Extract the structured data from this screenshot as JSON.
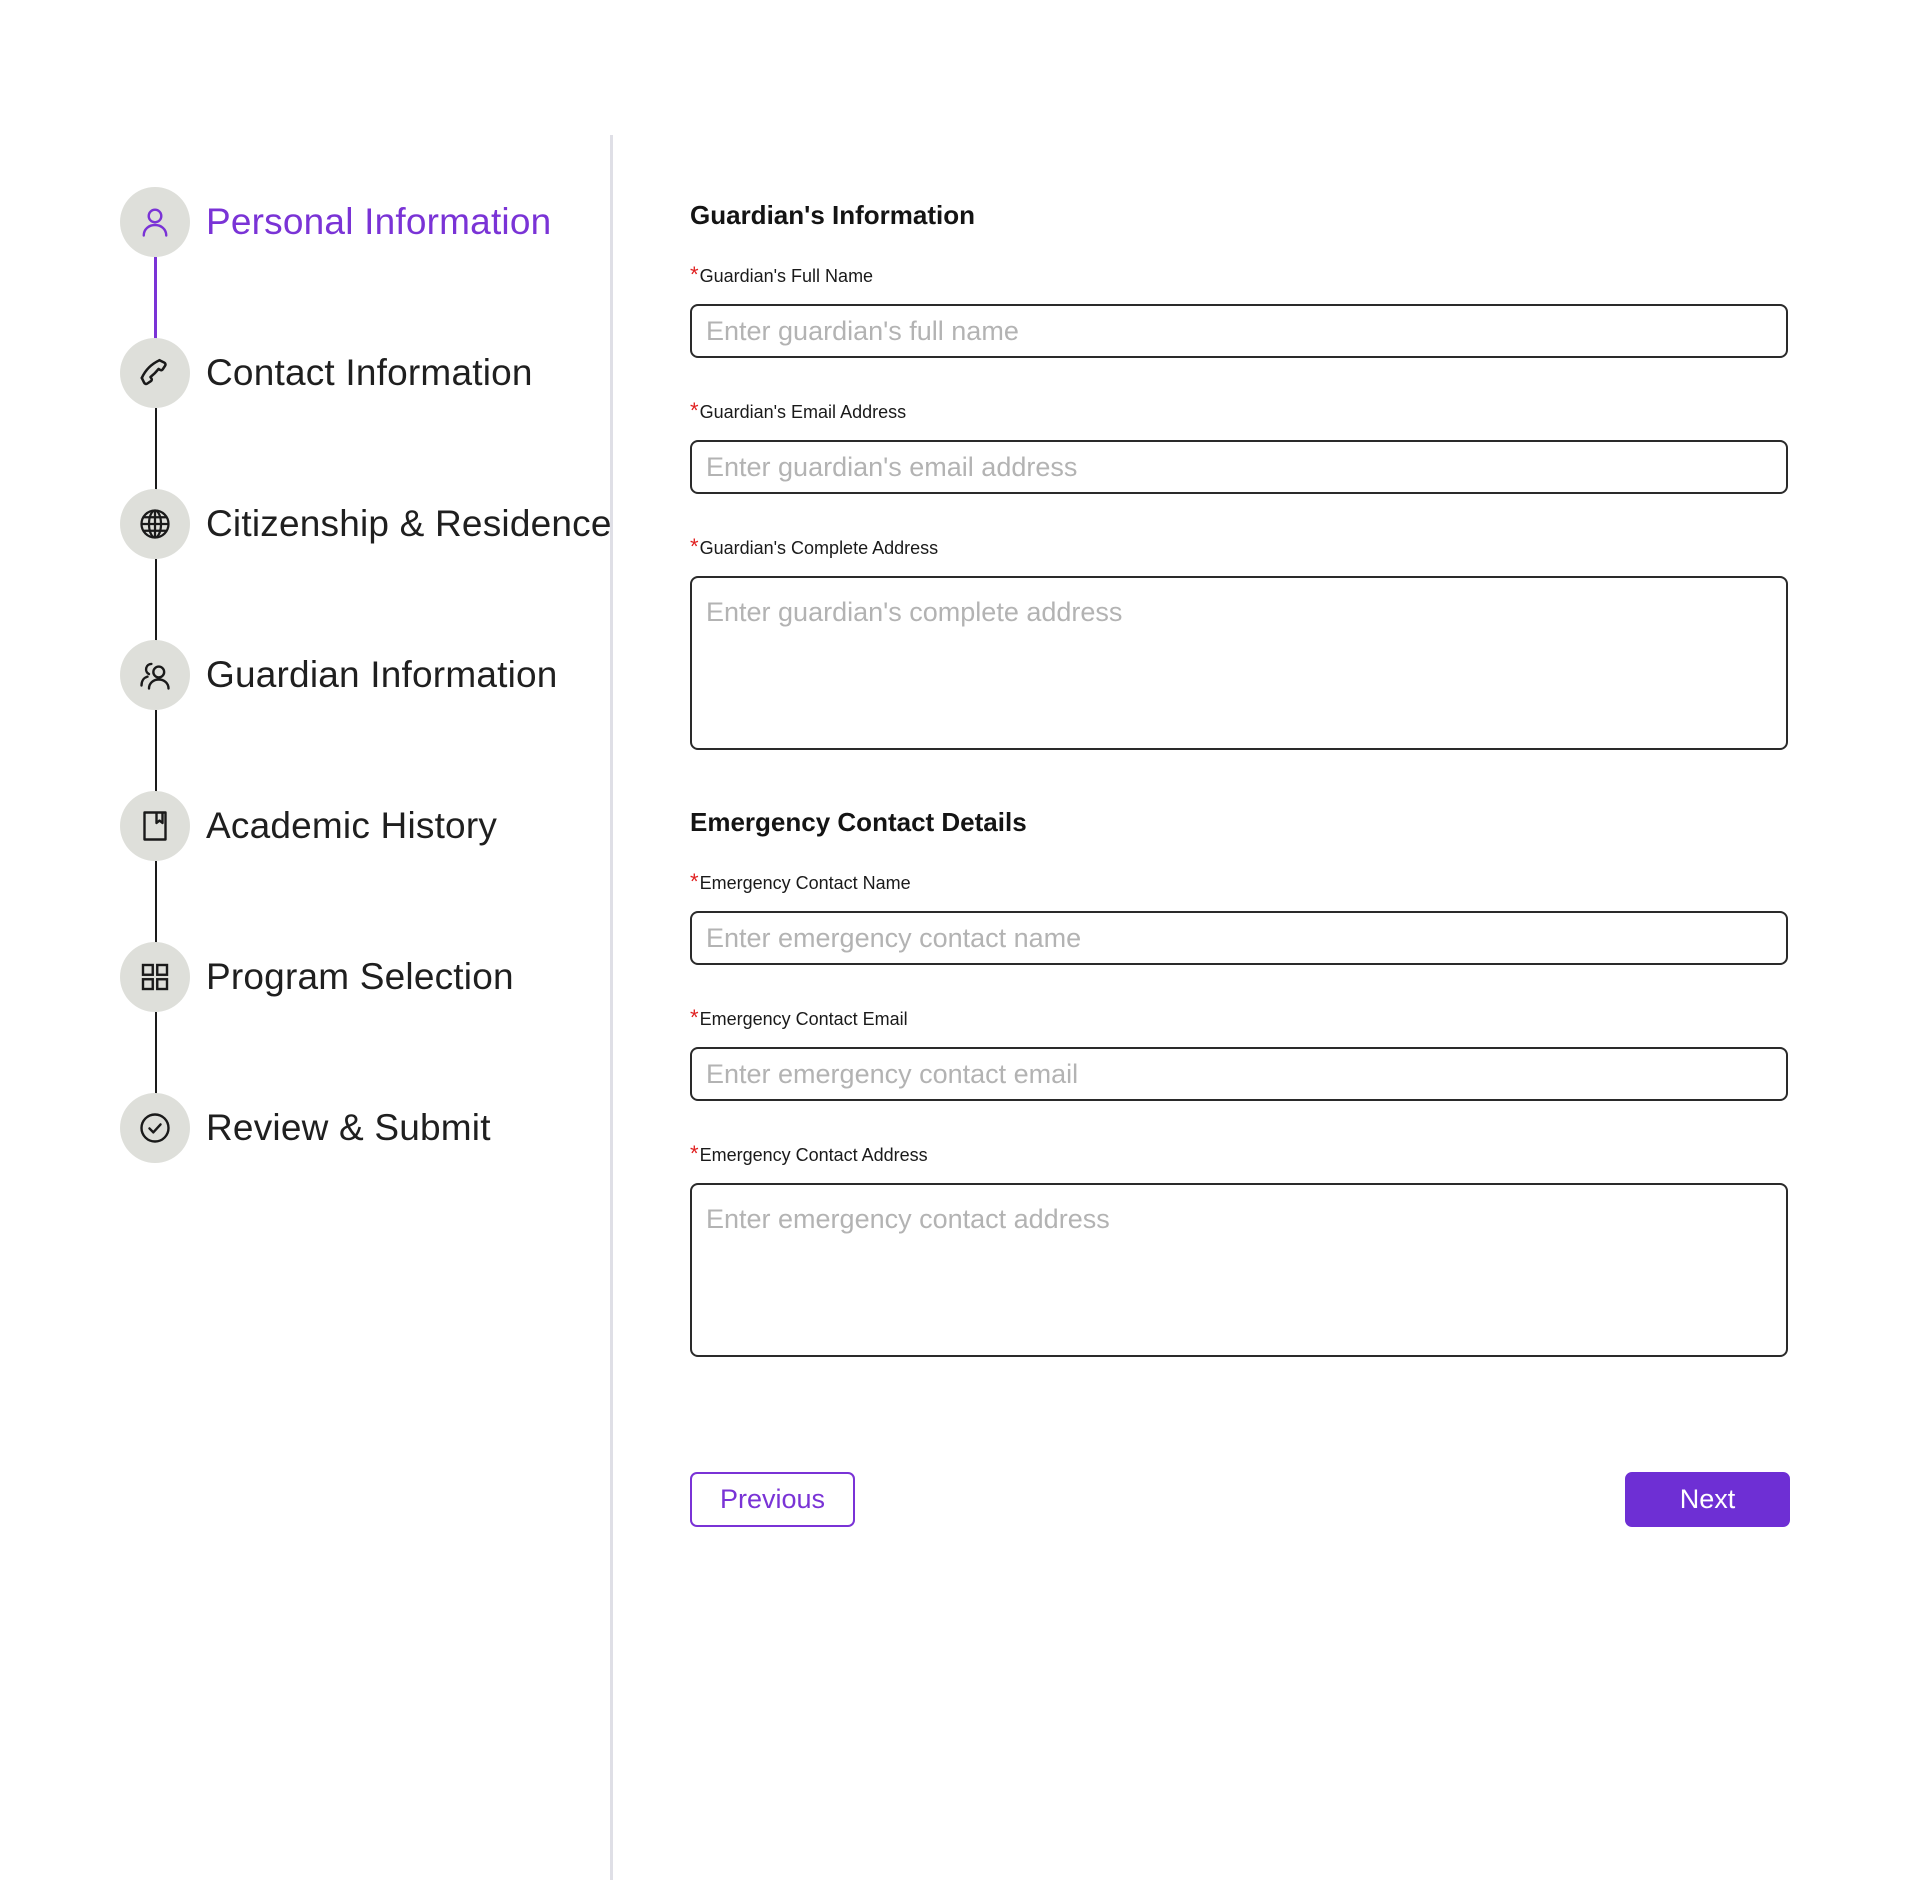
{
  "sidebar": {
    "steps": [
      {
        "label": "Personal Information",
        "icon": "user-icon",
        "active": true
      },
      {
        "label": "Contact Information",
        "icon": "phone-icon",
        "active": false
      },
      {
        "label": "Citizenship & Residence",
        "icon": "globe-icon",
        "active": false
      },
      {
        "label": "Guardian Information",
        "icon": "users-icon",
        "active": false
      },
      {
        "label": "Academic History",
        "icon": "book-icon",
        "active": false
      },
      {
        "label": "Program Selection",
        "icon": "grid-icon",
        "active": false
      },
      {
        "label": "Review & Submit",
        "icon": "check-circle-icon",
        "active": false
      }
    ]
  },
  "guardian": {
    "title": "Guardian's Information",
    "full_name": {
      "label": "Guardian's Full Name",
      "placeholder": "Enter guardian's full name",
      "value": ""
    },
    "email": {
      "label": "Guardian's Email Address",
      "placeholder": "Enter guardian's email address",
      "value": ""
    },
    "address": {
      "label": "Guardian's Complete Address",
      "placeholder": "Enter guardian's complete address",
      "value": ""
    }
  },
  "emergency": {
    "title": "Emergency Contact Details",
    "name": {
      "label": "Emergency Contact Name",
      "placeholder": "Enter emergency contact name",
      "value": ""
    },
    "email": {
      "label": "Emergency Contact Email",
      "placeholder": "Enter emergency contact email",
      "value": ""
    },
    "address": {
      "label": "Emergency Contact Address",
      "placeholder": "Enter emergency contact address",
      "value": ""
    }
  },
  "required_marker": "*",
  "buttons": {
    "previous": "Previous",
    "next": "Next"
  },
  "colors": {
    "accent": "#7a33d6",
    "primary_button": "#6e2fd4",
    "required": "#e02020",
    "step_circle": "#dedfda",
    "placeholder": "#b3b3b3"
  }
}
